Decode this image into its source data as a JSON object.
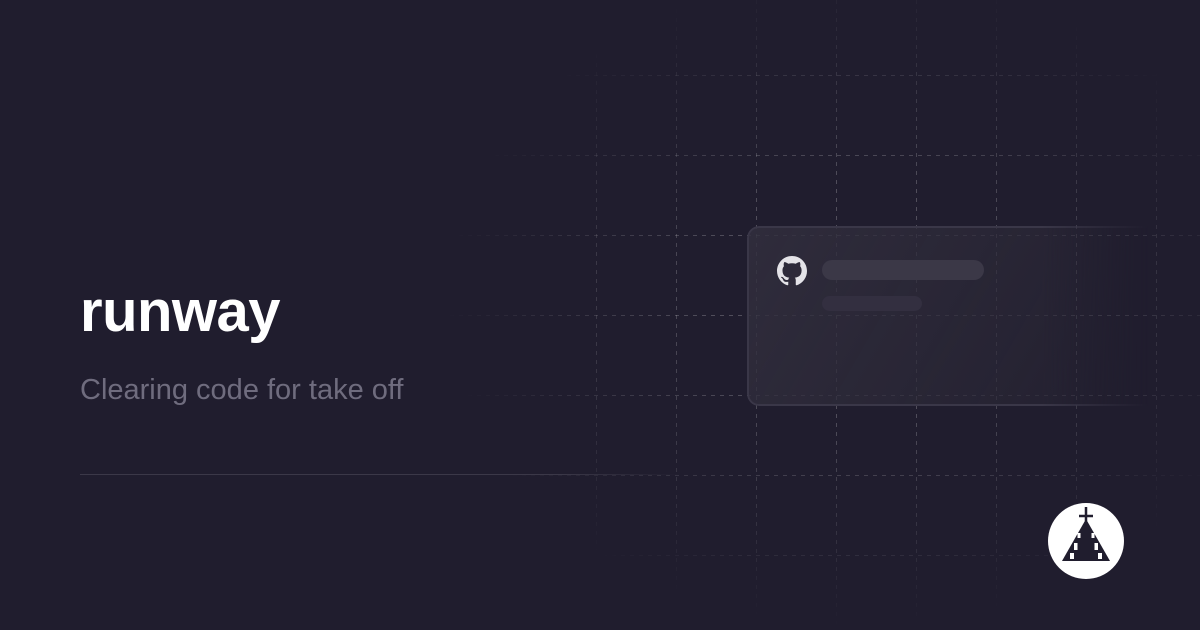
{
  "brand": {
    "title": "runway",
    "tagline": "Clearing code for take off"
  },
  "card": {
    "icon": "github-icon"
  },
  "logo": {
    "icon": "runway-logo-icon"
  },
  "colors": {
    "background": "#201d2e",
    "title": "#ffffff",
    "tagline": "#6f6c7e"
  }
}
